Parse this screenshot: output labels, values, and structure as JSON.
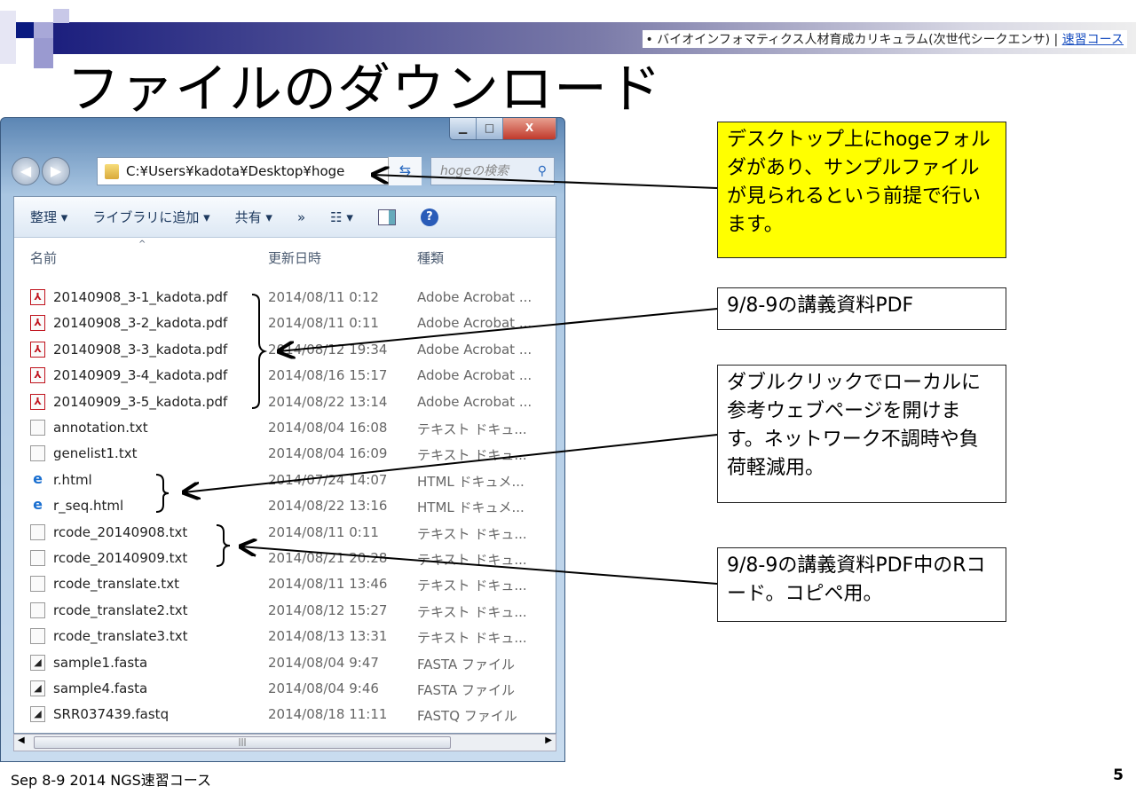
{
  "header": {
    "note": "• バイオインフォマティクス人材育成カリキュラム(次世代シークエンサ) | ",
    "note_link": "速習コース",
    "title": "ファイルのダウンロード"
  },
  "explorer": {
    "address": "C:¥Users¥kadota¥Desktop¥hoge",
    "search_placeholder": "hogeの検索",
    "toolbar": [
      "整理 ▾",
      "ライブラリに追加 ▾",
      "共有 ▾",
      "»",
      "☷ ▾"
    ],
    "columns": [
      "名前",
      "更新日時",
      "種類"
    ],
    "files": [
      {
        "name": "20140908_3-1_kadota.pdf",
        "date": "2014/08/11 0:12",
        "type": "Adobe Acrobat ...",
        "icon": "pdf"
      },
      {
        "name": "20140908_3-2_kadota.pdf",
        "date": "2014/08/11 0:11",
        "type": "Adobe Acrobat ...",
        "icon": "pdf"
      },
      {
        "name": "20140908_3-3_kadota.pdf",
        "date": "2014/08/12 19:34",
        "type": "Adobe Acrobat ...",
        "icon": "pdf"
      },
      {
        "name": "20140909_3-4_kadota.pdf",
        "date": "2014/08/16 15:17",
        "type": "Adobe Acrobat ...",
        "icon": "pdf"
      },
      {
        "name": "20140909_3-5_kadota.pdf",
        "date": "2014/08/22 13:14",
        "type": "Adobe Acrobat ...",
        "icon": "pdf"
      },
      {
        "name": "annotation.txt",
        "date": "2014/08/04 16:08",
        "type": "テキスト ドキュ...",
        "icon": "txt"
      },
      {
        "name": "genelist1.txt",
        "date": "2014/08/04 16:09",
        "type": "テキスト ドキュ...",
        "icon": "txt"
      },
      {
        "name": "r.html",
        "date": "2014/07/24 14:07",
        "type": "HTML ドキュメ...",
        "icon": "html"
      },
      {
        "name": "r_seq.html",
        "date": "2014/08/22 13:16",
        "type": "HTML ドキュメ...",
        "icon": "html"
      },
      {
        "name": "rcode_20140908.txt",
        "date": "2014/08/11 0:11",
        "type": "テキスト ドキュ...",
        "icon": "txt"
      },
      {
        "name": "rcode_20140909.txt",
        "date": "2014/08/21 20:28",
        "type": "テキスト ドキュ...",
        "icon": "txt"
      },
      {
        "name": "rcode_translate.txt",
        "date": "2014/08/11 13:46",
        "type": "テキスト ドキュ...",
        "icon": "txt"
      },
      {
        "name": "rcode_translate2.txt",
        "date": "2014/08/12 15:27",
        "type": "テキスト ドキュ...",
        "icon": "txt"
      },
      {
        "name": "rcode_translate3.txt",
        "date": "2014/08/13 13:31",
        "type": "テキスト ドキュ...",
        "icon": "txt"
      },
      {
        "name": "sample1.fasta",
        "date": "2014/08/04 9:47",
        "type": "FASTA ファイル",
        "icon": "fasta"
      },
      {
        "name": "sample4.fasta",
        "date": "2014/08/04 9:46",
        "type": "FASTA ファイル",
        "icon": "fasta"
      },
      {
        "name": "SRR037439.fastq",
        "date": "2014/08/18 11:11",
        "type": "FASTQ ファイル",
        "icon": "fasta"
      }
    ]
  },
  "callouts": [
    "デスクトップ上にhogeフォルダがあり、サンプルファイルが見られるという前提で行います。",
    "9/8-9の講義資料PDF",
    "ダブルクリックでローカルに参考ウェブページを開けます。ネットワーク不調時や負荷軽減用。",
    "9/8-9の講義資料PDF中のRコード。コピペ用。"
  ],
  "footer": {
    "left": "Sep 8-9 2014 NGS速習コース",
    "page": "5"
  },
  "colors": {
    "callout_yellow": "#ffff00",
    "band": "#1c1f7e"
  }
}
